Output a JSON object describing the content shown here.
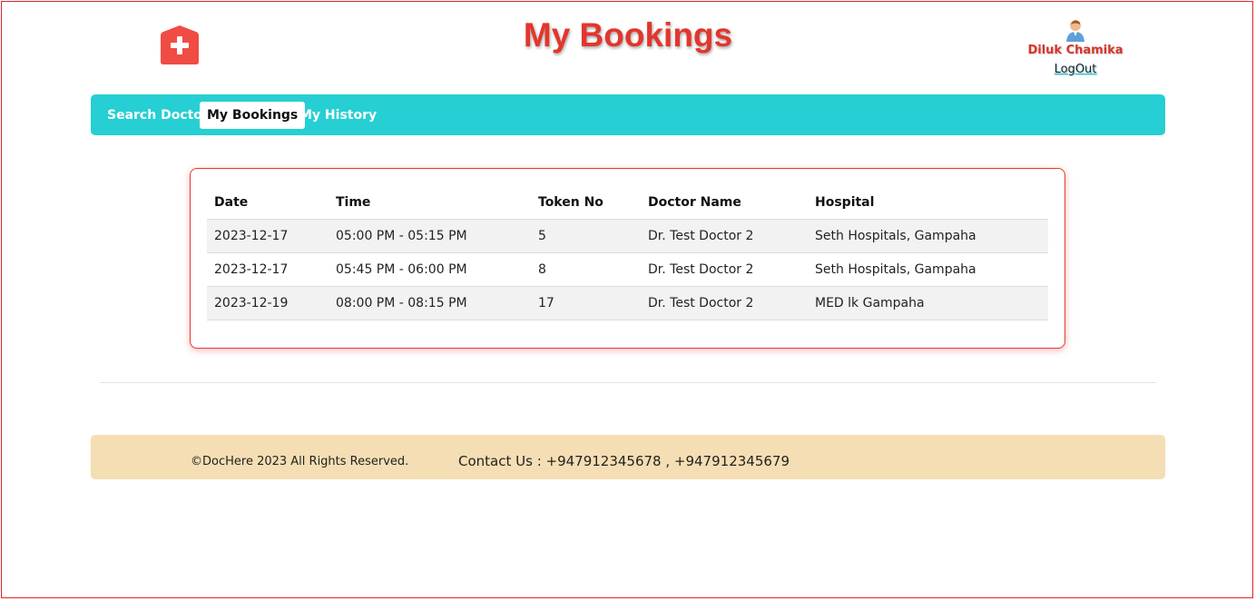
{
  "header": {
    "title": "My Bookings",
    "logo_icon": "medical-cross-icon",
    "user": {
      "name": "Diluk Chamika",
      "avatar_icon": "user-avatar-icon",
      "logout_label": "LogOut"
    }
  },
  "nav": {
    "items": [
      {
        "label": "Search Doctor",
        "active": false
      },
      {
        "label": "My Bookings",
        "active": true
      },
      {
        "label": "My History",
        "active": false
      }
    ]
  },
  "bookings": {
    "columns": [
      "Date",
      "Time",
      "Token No",
      "Doctor Name",
      "Hospital"
    ],
    "rows": [
      [
        "2023-12-17",
        "05:00 PM - 05:15 PM",
        "5",
        "Dr. Test Doctor 2",
        "Seth Hospitals, Gampaha"
      ],
      [
        "2023-12-17",
        "05:45 PM - 06:00 PM",
        "8",
        "Dr. Test Doctor 2",
        "Seth Hospitals, Gampaha"
      ],
      [
        "2023-12-19",
        "08:00 PM - 08:15 PM",
        "17",
        "Dr. Test Doctor 2",
        "MED lk Gampaha"
      ]
    ]
  },
  "footer": {
    "copyright": "©DocHere 2023 All Rights Reserved.",
    "contact": "Contact Us : +947912345678 , +947912345679"
  },
  "colors": {
    "accent_red": "#e2362d",
    "nav_bg": "#26cfd3",
    "footer_bg": "#f5deb3"
  }
}
